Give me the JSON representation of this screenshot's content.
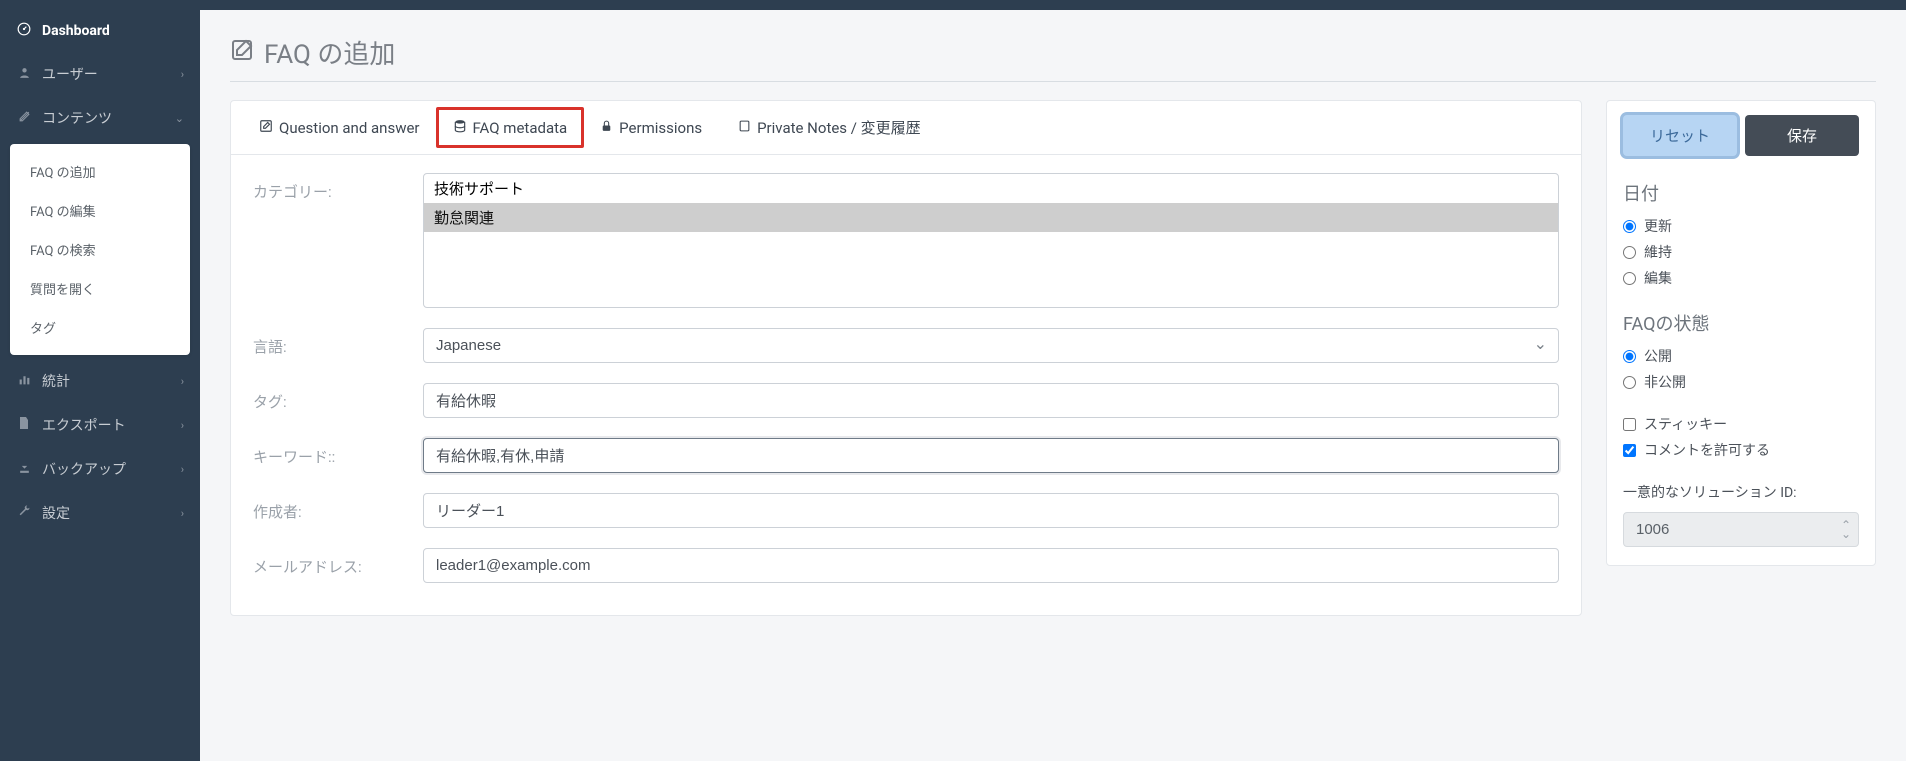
{
  "sidebar": {
    "dashboard": "Dashboard",
    "user": "ユーザー",
    "contents": "コンテンツ",
    "contents_sub": {
      "add_faq": "FAQ の追加",
      "edit_faq": "FAQ の編集",
      "search_faq": "FAQ の検索",
      "open_question": "質問を開く",
      "tag": "タグ"
    },
    "stats": "統計",
    "export": "エクスポート",
    "backup": "バックアップ",
    "settings": "設定"
  },
  "page": {
    "title": "FAQ の追加"
  },
  "tabs": {
    "qa": "Question and answer",
    "meta": "FAQ metadata",
    "perm": "Permissions",
    "notes": "Private Notes / 変更履歴"
  },
  "form": {
    "labels": {
      "category": "カテゴリー:",
      "language": "言語:",
      "tag": "タグ:",
      "keyword": "キーワード::",
      "author": "作成者:",
      "email": "メールアドレス:"
    },
    "category_options": {
      "tech": "技術サポート",
      "attendance": "勤怠関連"
    },
    "language_value": "Japanese",
    "tag_value": "有給休暇",
    "keyword_value": "有給休暇,有休,申請",
    "author_value": "リーダー1",
    "email_value": "leader1@example.com"
  },
  "right": {
    "reset": "リセット",
    "save": "保存",
    "date_title": "日付",
    "date_opts": {
      "update": "更新",
      "keep": "維持",
      "edit": "編集"
    },
    "status_title": "FAQの状態",
    "status_opts": {
      "public": "公開",
      "private": "非公開"
    },
    "sticky": "スティッキー",
    "comments": "コメントを許可する",
    "solution_title": "一意的なソリューション ID:",
    "solution_value": "1006"
  }
}
